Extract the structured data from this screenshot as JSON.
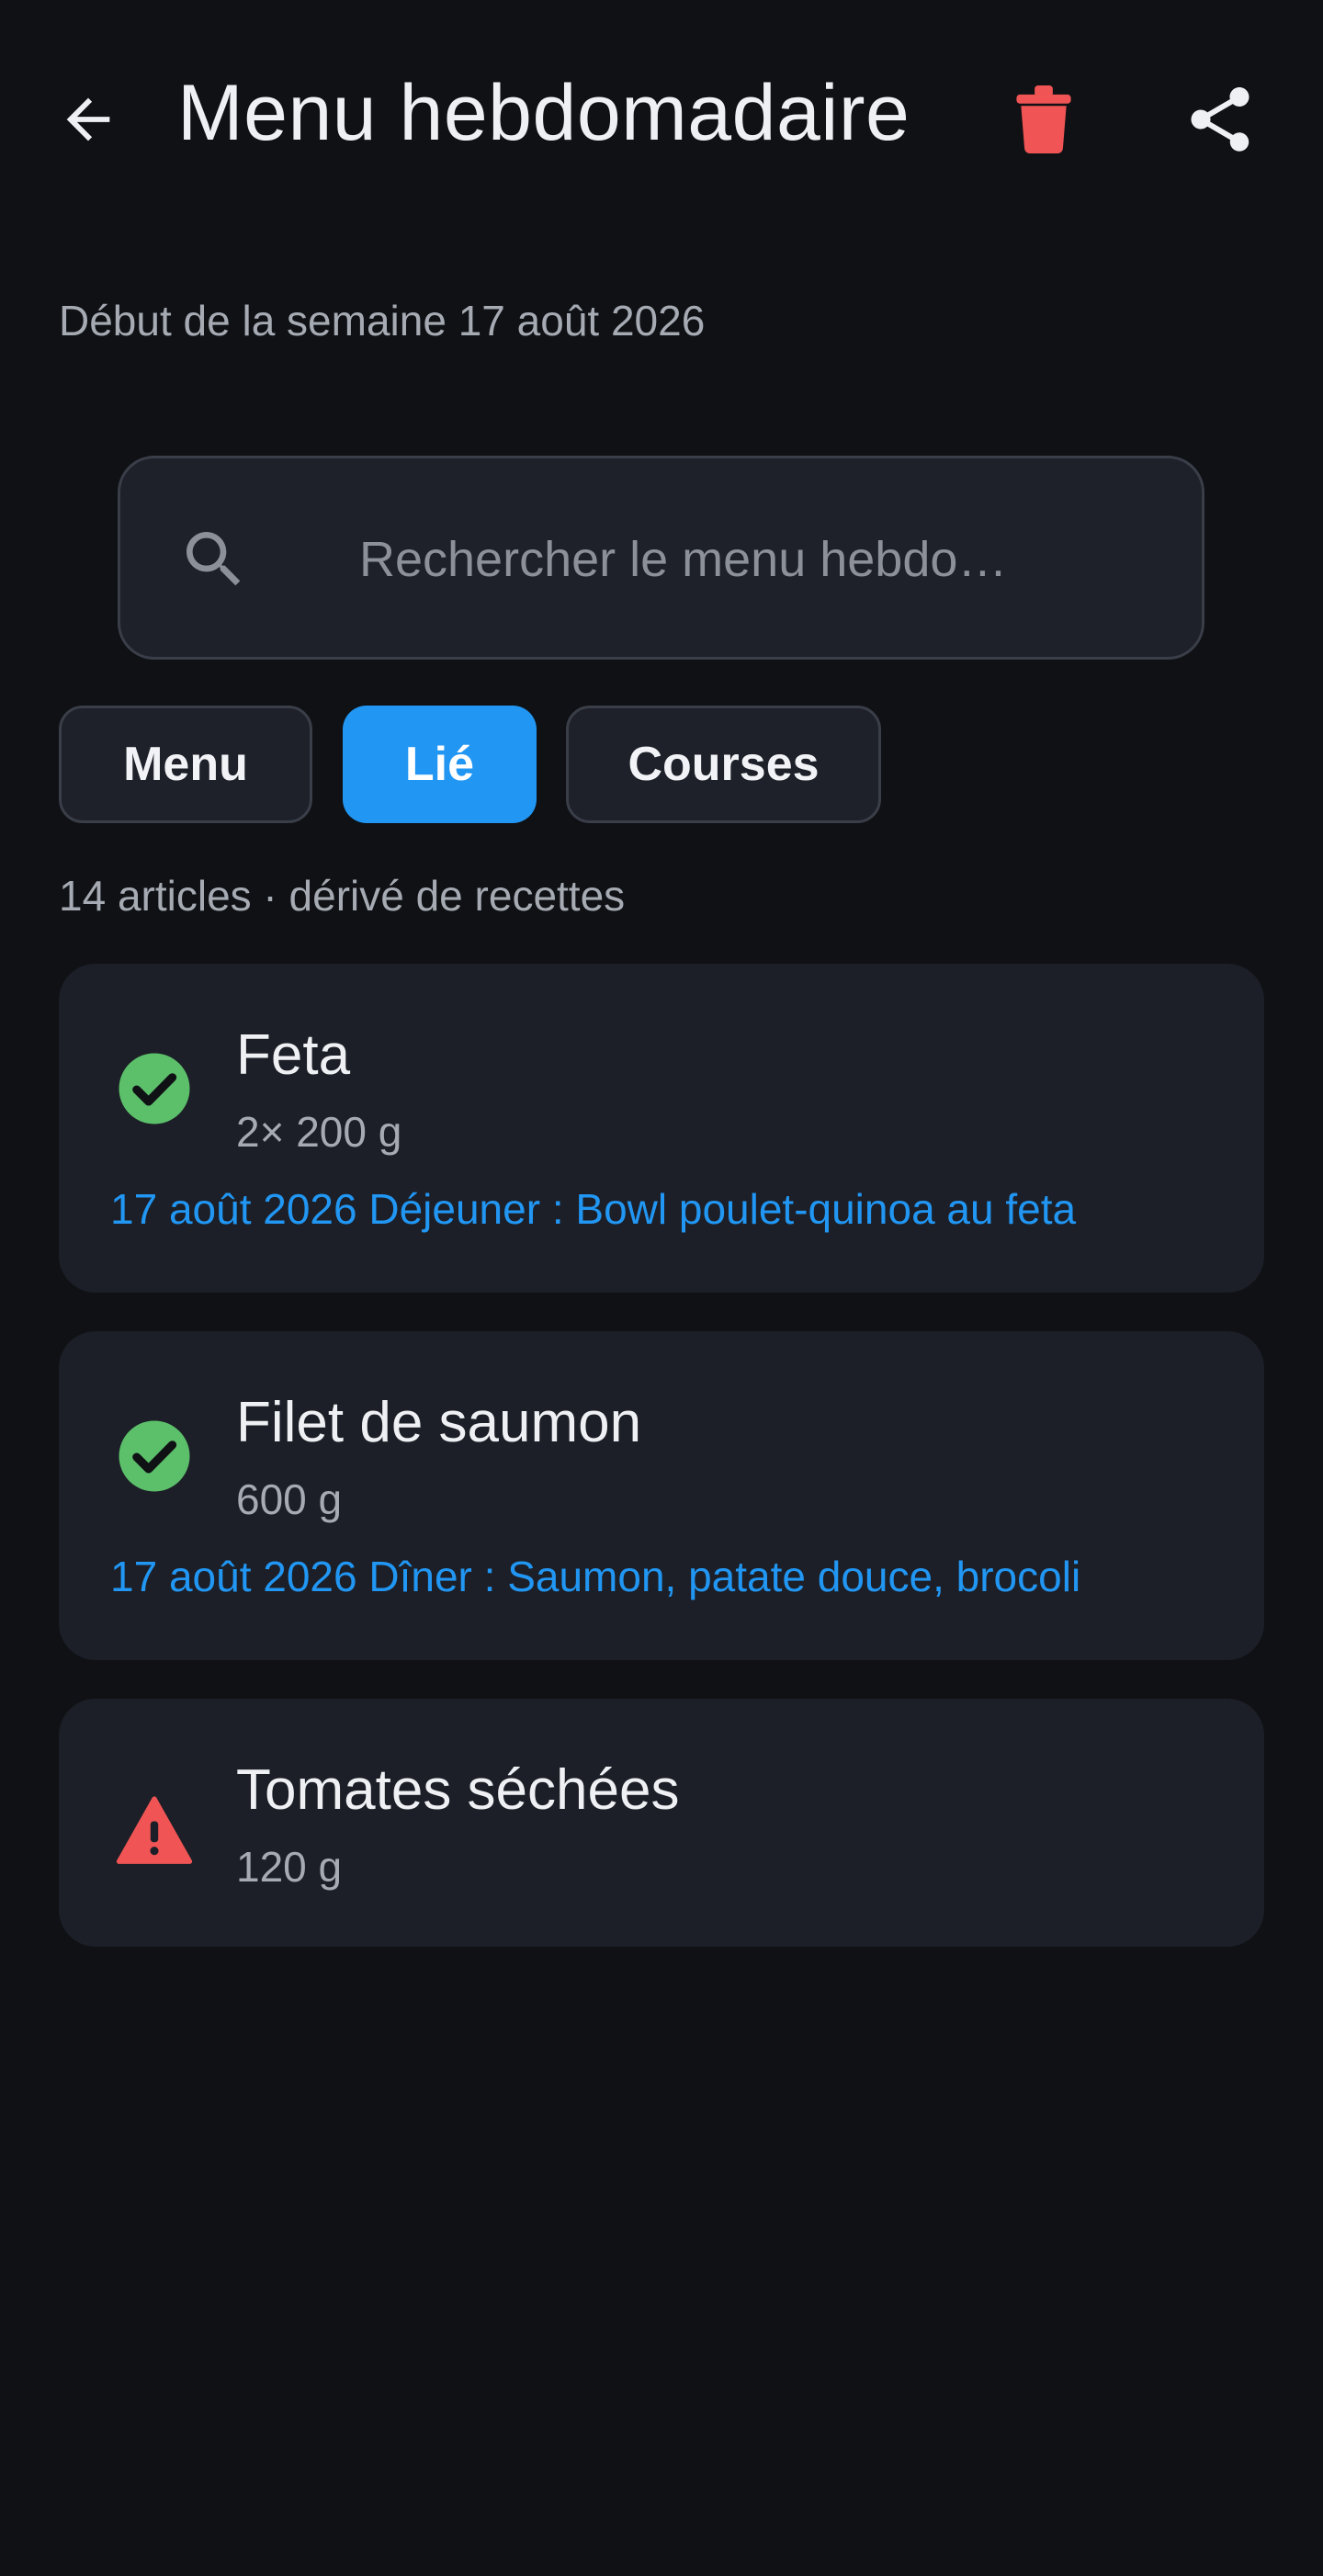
{
  "header": {
    "title": "Menu hebdomadaire",
    "back_icon": "arrow-left-icon",
    "delete_icon": "trash-icon",
    "share_icon": "share-icon"
  },
  "week": {
    "label": "Début de la semaine 17 août 2026"
  },
  "search": {
    "placeholder": "Rechercher le menu hebdo…",
    "value": ""
  },
  "tabs": [
    {
      "label": "Menu",
      "active": false
    },
    {
      "label": "Lié",
      "active": true
    },
    {
      "label": "Courses",
      "active": false
    }
  ],
  "summary": "14 articles · dérivé de recettes",
  "items": [
    {
      "name": "Feta",
      "quantity": "2× 200 g",
      "status": "check-circle-icon",
      "link": "17 août 2026 Déjeuner : Bowl poulet-quinoa au feta"
    },
    {
      "name": "Filet de saumon",
      "quantity": "600 g",
      "status": "check-circle-icon",
      "link": "17 août 2026 Dîner : Saumon, patate douce, brocoli"
    },
    {
      "name": "Tomates séchées",
      "quantity": "120 g",
      "status": "warning-icon"
    }
  ],
  "colors": {
    "background": "#0f1115",
    "card": "#1c1f27",
    "accent": "#2196f3",
    "success": "#5cbf6a",
    "danger": "#f05454"
  }
}
